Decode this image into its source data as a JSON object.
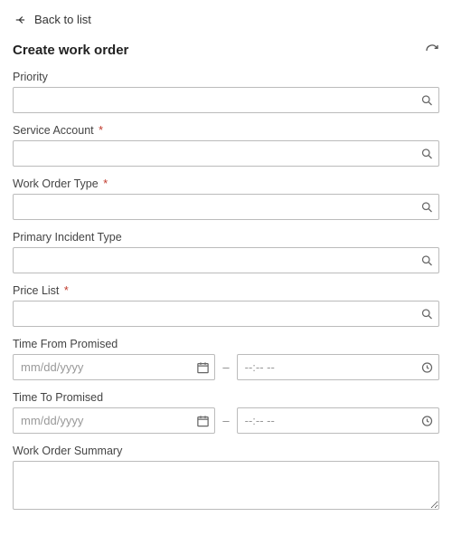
{
  "nav": {
    "back": "Back to list"
  },
  "page": {
    "title": "Create work order"
  },
  "fields": {
    "priority": {
      "label": "Priority",
      "required": false,
      "value": ""
    },
    "serviceAccount": {
      "label": "Service Account",
      "required": true,
      "value": ""
    },
    "workOrderType": {
      "label": "Work Order Type",
      "required": true,
      "value": ""
    },
    "incidentType": {
      "label": "Primary Incident Type",
      "required": false,
      "value": ""
    },
    "priceList": {
      "label": "Price List",
      "required": true,
      "value": ""
    },
    "timeFrom": {
      "label": "Time From Promised",
      "datePlaceholder": "mm/dd/yyyy",
      "timePlaceholder": "--:-- --",
      "date": "",
      "time": ""
    },
    "timeTo": {
      "label": "Time To Promised",
      "datePlaceholder": "mm/dd/yyyy",
      "timePlaceholder": "--:-- --",
      "date": "",
      "time": ""
    },
    "summary": {
      "label": "Work Order Summary",
      "value": ""
    }
  },
  "requiredMark": "*"
}
